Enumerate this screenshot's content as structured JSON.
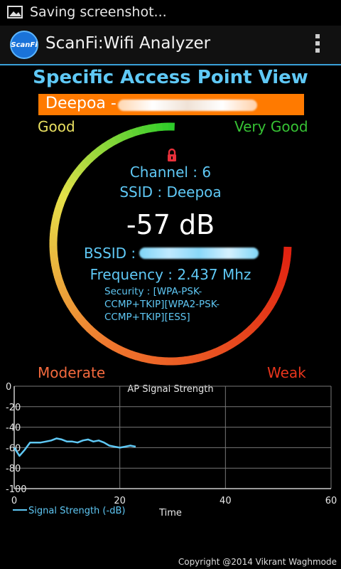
{
  "status_bar": {
    "text": "Saving screenshot..."
  },
  "app_bar": {
    "logo_text": "ScanFi",
    "title": "ScanFi:Wifi Analyzer"
  },
  "heading": "Specific Access Point View",
  "access_point": {
    "label": "Deepoa -"
  },
  "gauge": {
    "labels": {
      "good": "Good",
      "very_good": "Very Good",
      "moderate": "Moderate",
      "weak": "Weak"
    },
    "channel": "Channel : 6",
    "ssid": "SSID : Deepoa",
    "signal": "-57 dB",
    "bssid_label": "BSSID :",
    "frequency": "Frequency : 2.437 Mhz",
    "security": "Security : [WPA-PSK-CCMP+TKIP][WPA2-PSK-CCMP+TKIP][ESS]",
    "colors": {
      "green": "#2ecc2a",
      "yellow": "#e6e04a",
      "orange": "#f0782e",
      "red": "#e02010"
    }
  },
  "chart_data": {
    "type": "line",
    "title": "AP Signal Strength",
    "xlabel": "Time",
    "ylabel": "",
    "xlim": [
      0,
      60
    ],
    "ylim": [
      -100,
      0
    ],
    "x_ticks": [
      0,
      20,
      40,
      60
    ],
    "y_ticks": [
      0,
      -20,
      -40,
      -60,
      -80,
      -100
    ],
    "grid": true,
    "legend_position": "bottom-left",
    "series": [
      {
        "name": "Signal Strength (-dB)",
        "color": "#5fc8f5",
        "x": [
          0,
          1,
          2,
          3,
          4,
          5,
          6,
          7,
          8,
          9,
          10,
          11,
          12,
          13,
          14,
          15,
          16,
          17,
          18,
          19,
          20,
          21,
          22,
          23
        ],
        "y": [
          -60,
          -68,
          -62,
          -55,
          -55,
          -55,
          -54,
          -53,
          -51,
          -52,
          -54,
          -54,
          -55,
          -53,
          -52,
          -54,
          -53,
          -55,
          -58,
          -59,
          -60,
          -59,
          -58,
          -59
        ]
      }
    ]
  },
  "footer": {
    "copyright": "Copyright @2014 Vikrant Waghmode"
  }
}
